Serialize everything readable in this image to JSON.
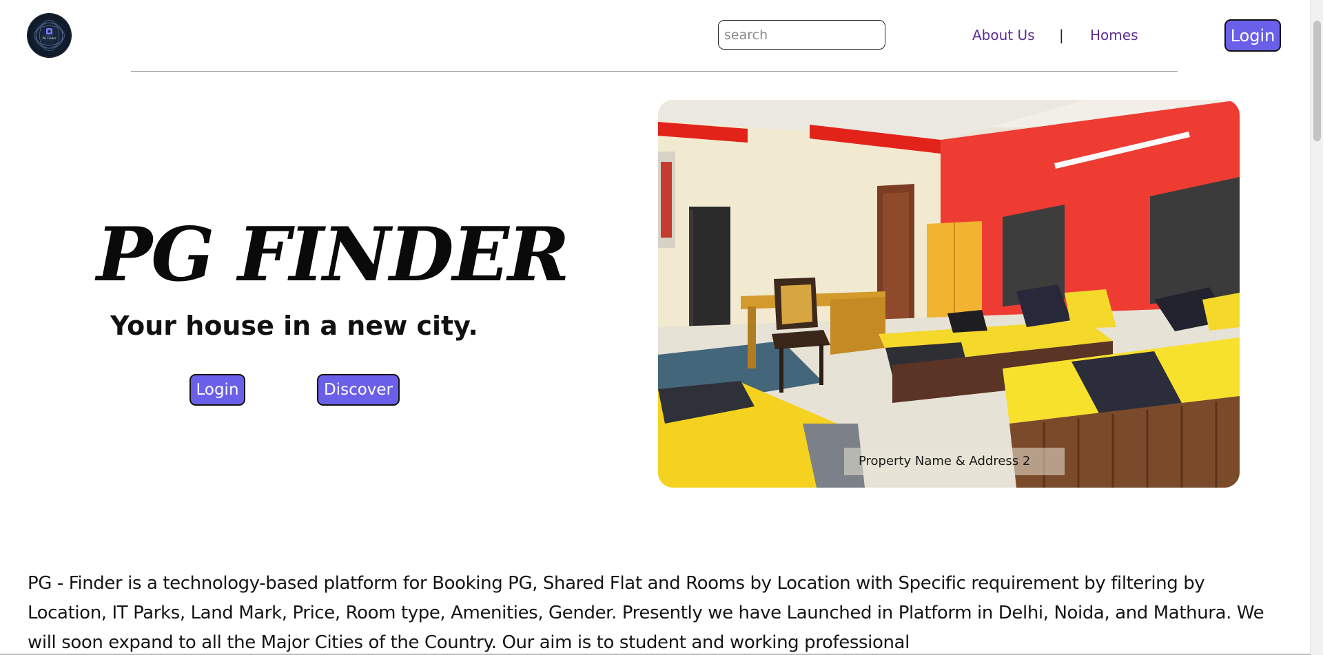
{
  "header": {
    "logo": {
      "icon": "pg-finder-logo",
      "text": "PG Finder"
    },
    "search": {
      "placeholder": "search",
      "value": ""
    },
    "nav": {
      "about_label": "About Us",
      "separator": "|",
      "homes_label": "Homes"
    },
    "login_label": "Login"
  },
  "hero": {
    "title": "PG FINDER",
    "subtitle": "Your house in a new city.",
    "login_label": "Login",
    "discover_label": "Discover",
    "image": {
      "caption": "Property Name & Address 2"
    }
  },
  "about": {
    "text": "PG - Finder is a technology-based platform for Booking PG, Shared Flat and Rooms by Location with Specific requirement by filtering by Location, IT Parks, Land Mark, Price, Room type, Amenities, Gender. Presently we have Launched in Platform in Delhi, Noida, and Mathura. We will soon expand to all the Major Cities of the Country. Our aim is to student and working professional"
  },
  "colors": {
    "accent_button": "#6a5fe8",
    "nav_link": "#5a2d91",
    "logo_bg": "#0d1828"
  }
}
